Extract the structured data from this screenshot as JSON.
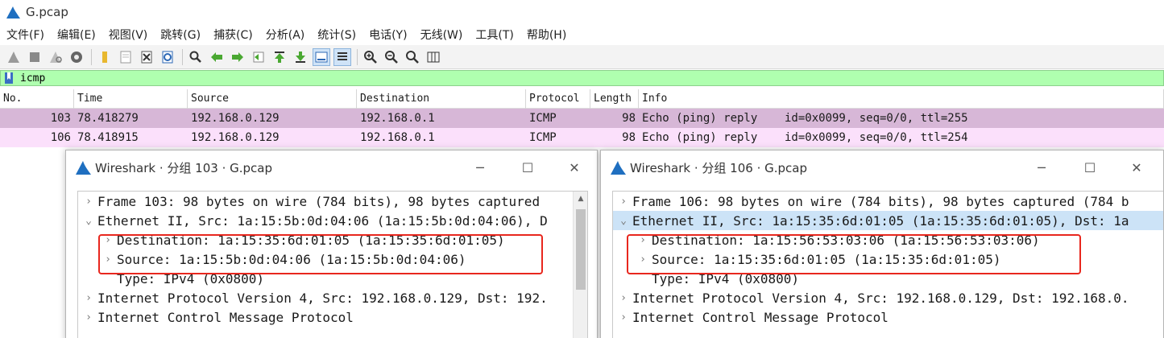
{
  "window": {
    "title": "G.pcap"
  },
  "menu": [
    "文件(F)",
    "编辑(E)",
    "视图(V)",
    "跳转(G)",
    "捕获(C)",
    "分析(A)",
    "统计(S)",
    "电话(Y)",
    "无线(W)",
    "工具(T)",
    "帮助(H)"
  ],
  "toolbar_icons": [
    "start-capture-icon",
    "stop-capture-icon",
    "restart-capture-icon",
    "capture-options-icon",
    "open-file-icon",
    "save-file-icon",
    "close-file-icon",
    "reload-file-icon",
    "find-packet-icon",
    "go-back-icon",
    "go-forward-icon",
    "go-to-packet-icon",
    "go-first-icon",
    "go-last-icon",
    "autoscroll-icon",
    "colorize-icon",
    "zoom-in-icon",
    "zoom-out-icon",
    "zoom-normal-icon",
    "resize-columns-icon"
  ],
  "filter": {
    "value": "icmp"
  },
  "packet_list": {
    "columns": [
      "No.",
      "Time",
      "Source",
      "Destination",
      "Protocol",
      "Length",
      "Info"
    ],
    "rows": [
      {
        "no": "103",
        "time": "78.418279",
        "src": "192.168.0.129",
        "dst": "192.168.0.1",
        "proto": "ICMP",
        "len": "98",
        "info": "Echo (ping) reply    id=0x0099, seq=0/0, ttl=255"
      },
      {
        "no": "106",
        "time": "78.418915",
        "src": "192.168.0.129",
        "dst": "192.168.0.1",
        "proto": "ICMP",
        "len": "98",
        "info": "Echo (ping) reply    id=0x0099, seq=0/0, ttl=254"
      }
    ]
  },
  "dialog1": {
    "title": "Wireshark · 分组 103 · G.pcap",
    "lines": [
      {
        "arrow": "›",
        "text": "Frame 103: 98 bytes on wire (784 bits), 98 bytes captured"
      },
      {
        "arrow": "⌄",
        "text": "Ethernet II, Src: 1a:15:5b:0d:04:06 (1a:15:5b:0d:04:06), D"
      },
      {
        "arrow": "›",
        "text": "Destination: 1a:15:35:6d:01:05 (1a:15:35:6d:01:05)"
      },
      {
        "arrow": "›",
        "text": "Source: 1a:15:5b:0d:04:06 (1a:15:5b:0d:04:06)"
      },
      {
        "arrow": "",
        "text": "Type: IPv4 (0x0800)"
      },
      {
        "arrow": "›",
        "text": "Internet Protocol Version 4, Src: 192.168.0.129, Dst: 192."
      },
      {
        "arrow": "›",
        "text": "Internet Control Message Protocol"
      }
    ]
  },
  "dialog2": {
    "title": "Wireshark · 分组 106 · G.pcap",
    "lines": [
      {
        "arrow": "›",
        "text": "Frame 106: 98 bytes on wire (784 bits), 98 bytes captured (784 b"
      },
      {
        "arrow": "⌄",
        "text": "Ethernet II, Src: 1a:15:35:6d:01:05 (1a:15:35:6d:01:05), Dst: 1a"
      },
      {
        "arrow": "›",
        "text": "Destination: 1a:15:56:53:03:06 (1a:15:56:53:03:06)"
      },
      {
        "arrow": "›",
        "text": "Source: 1a:15:35:6d:01:05 (1a:15:35:6d:01:05)"
      },
      {
        "arrow": "",
        "text": "Type: IPv4 (0x0800)"
      },
      {
        "arrow": "›",
        "text": "Internet Protocol Version 4, Src: 192.168.0.129, Dst: 192.168.0."
      },
      {
        "arrow": "›",
        "text": "Internet Control Message Protocol"
      }
    ]
  },
  "colors": {
    "filter_ok": "#afffaf",
    "row_selected": "#d7b7d7",
    "row_icmp": "#fbe0fb",
    "highlight_box": "#e8271e",
    "tree_selected": "#cce3f7"
  }
}
